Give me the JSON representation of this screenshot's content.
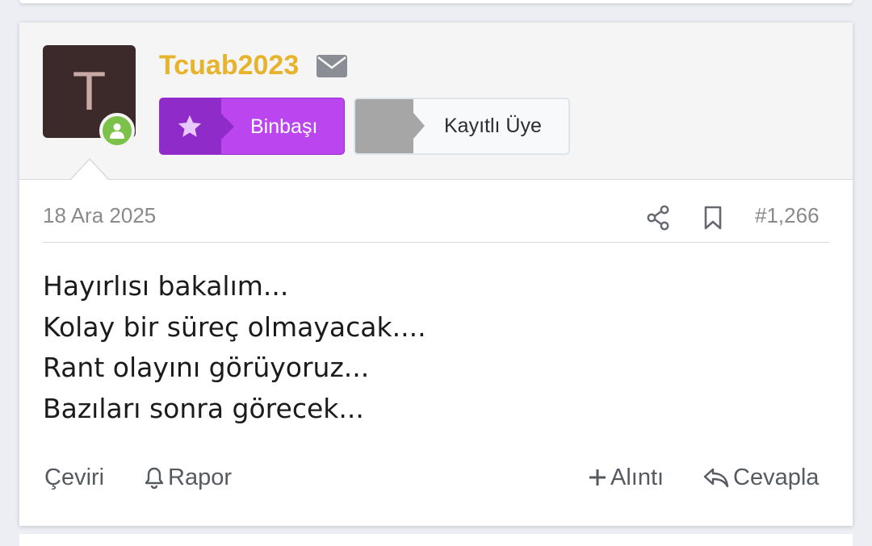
{
  "post": {
    "author": {
      "avatar_letter": "T",
      "username": "Tcuab2023",
      "username_color": "#e8b32c",
      "status": "online"
    },
    "banners": [
      {
        "label": "Binbaşı",
        "icon": "star-icon",
        "color": "#bb46f0"
      },
      {
        "label": "Kayıtlı Üye",
        "color": "#f7f9fb"
      }
    ],
    "date": "18 Ara 2025",
    "number": "#1,266",
    "lines": [
      "Hayırlısı bakalım...",
      "Kolay bir süreç olmayacak....",
      "Rant olayını görüyoruz...",
      "Bazıları sonra görecek..."
    ],
    "actions": {
      "translate": "Çeviri",
      "report": "Rapor",
      "quote": "Alıntı",
      "reply": "Cevapla"
    }
  }
}
